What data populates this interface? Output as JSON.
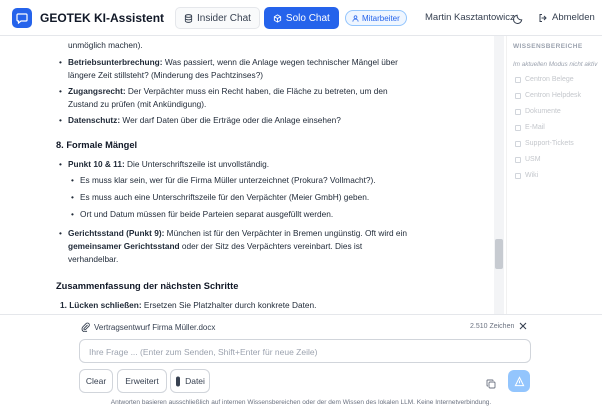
{
  "header": {
    "app_title": "GEOTEK KI-Assistent",
    "modes": [
      {
        "label": "Insider Chat",
        "icon": "database-icon",
        "active": false
      },
      {
        "label": "Solo Chat",
        "icon": "cube-icon",
        "active": true
      }
    ],
    "role_badge": "Mitarbeiter",
    "user_name": "Martin Kasztantowicz",
    "logout_label": "Abmelden"
  },
  "content": {
    "intro_tail": "unmöglich machen).",
    "rights_items": [
      {
        "bold": "Betriebsunterbrechung:",
        "text": " Was passiert, wenn die Anlage wegen technischer Mängel über längere Zeit stillsteht? (Minderung des Pachtzinses?)"
      },
      {
        "bold": "Zugangsrecht:",
        "text": " Der Verpächter muss ein Recht haben, die Fläche zu betreten, um den Zustand zu prüfen (mit Ankündigung)."
      },
      {
        "bold": "Datenschutz:",
        "text": " Wer darf Daten über die Erträge oder die Anlage einsehen?"
      }
    ],
    "section8_title": "8. Formale Mängel",
    "point_sig": {
      "bold": "Punkt 10 & 11:",
      "text": " Die Unterschriftszeile ist unvollständig."
    },
    "sig_subitems": [
      "Es muss klar sein, wer für die Firma Müller unterzeichnet (Prokura? Vollmacht?).",
      "Es muss auch eine Unterschriftszeile für den Verpächter (Meier GmbH) geben.",
      "Ort und Datum müssen für beide Parteien separat ausgefüllt werden."
    ],
    "point_court": {
      "bold": "Gerichtsstand (Punkt 9):",
      "text1": " München ist für den Verpächter in Bremen ungünstig. Oft wird ein ",
      "bold2": "gemeinsamer Gerichtsstand",
      "text2": " oder der Sitz des Verpächters vereinbart. Dies ist verhandelbar."
    },
    "summary_title": "Zusammenfassung der nächsten Schritte",
    "summary_first": {
      "bold": "1. Lücken schließen:",
      "text": " Ersetzen Sie Platzhalter durch konkrete Daten."
    }
  },
  "sidebar": {
    "title": "WISSENSBEREICHE",
    "note": "Im aktuellen Modus nicht aktiv",
    "items": [
      "Centron Belege",
      "Centron Helpdesk",
      "Dokumente",
      "E-Mail",
      "Support-Tickets",
      "USM",
      "Wiki"
    ]
  },
  "composer": {
    "attachment_name": "Vertragsentwurf Firma Müller.docx",
    "attachment_size": "2.510 Zeichen",
    "placeholder": "Ihre Frage ... (Enter zum Senden, Shift+Enter für neue Zeile)",
    "clear_label": "Clear",
    "extended_label": "Erweitert",
    "file_label": "Datei",
    "footer_note": "Antworten basieren ausschließlich auf internen Wissensbereichen oder der dem Wissen des lokalen LLM. Keine Internetverbindung."
  },
  "colors": {
    "accent": "#2563eb",
    "send_disabled": "#93c5fd"
  }
}
